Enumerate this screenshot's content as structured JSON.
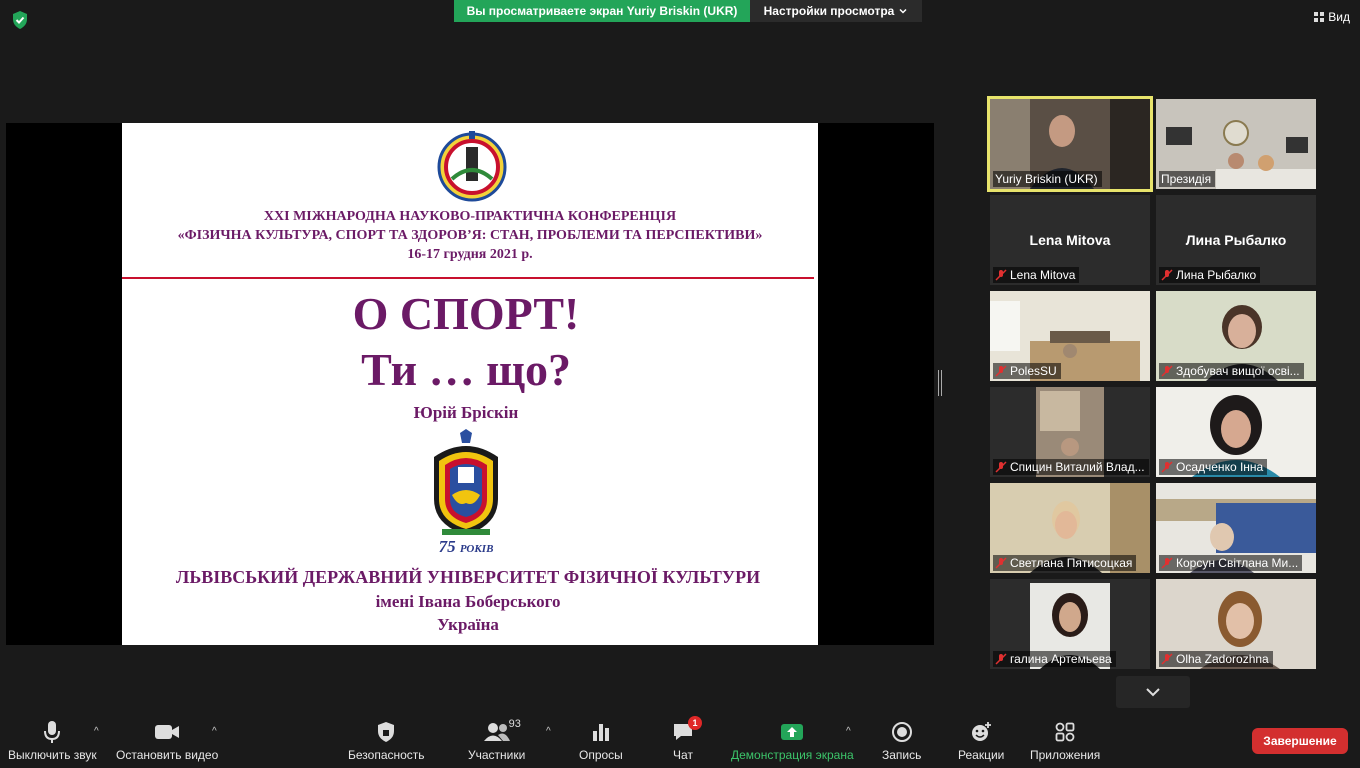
{
  "top": {
    "banner": "Вы просматриваете экран Yuriy Briskin (UKR)",
    "view_options": "Настройки просмотра",
    "view_button": "Вид"
  },
  "slide": {
    "conf_line1": "XXI МІЖНАРОДНА НАУКОВО-ПРАКТИЧНА КОНФЕРЕНЦІЯ",
    "conf_line2": "«ФІЗИЧНА КУЛЬТУРА, СПОРТ ТА ЗДОРОВ’Я: СТАН, ПРОБЛЕМИ ТА ПЕРСПЕКТИВИ»",
    "conf_dates": "16-17 грудня 2021 р.",
    "headline1": "О СПОРТ!",
    "headline2": "Ти … що?",
    "author": "Юрій Бріскін",
    "years_num": "75",
    "years_word": "РОКІВ",
    "univ_line1": "ЛЬВІВСЬКИЙ ДЕРЖАВНИЙ УНІВЕРСИТЕТ ФІЗИЧНОЇ КУЛЬТУРИ",
    "univ_line2": "імені Івана Боберського",
    "univ_line3": "Україна"
  },
  "participants": [
    {
      "label": "Yuriy Briskin (UKR)",
      "muted": false,
      "active": true
    },
    {
      "label": "Президія",
      "muted": false
    },
    {
      "label": "Lena Mitova",
      "name_card": "Lena Mitova",
      "muted": true
    },
    {
      "label": "Лина Рыбалко",
      "name_card": "Лина Рыбалко",
      "muted": true
    },
    {
      "label": "PolesSU",
      "muted": true
    },
    {
      "label": "Здобувач вищої осві...",
      "muted": true
    },
    {
      "label": "Спицин Виталий Влад...",
      "muted": true
    },
    {
      "label": "Осадченко Інна",
      "muted": true
    },
    {
      "label": "Светлана Пятисоцкая",
      "muted": true
    },
    {
      "label": "Корсун Світлана Ми...",
      "muted": true
    },
    {
      "label": "галина Артемьева",
      "muted": true
    },
    {
      "label": "Olha Zadorozhna",
      "muted": true
    }
  ],
  "toolbar": {
    "mute": "Выключить звук",
    "video": "Остановить видео",
    "security": "Безопасность",
    "participants": "Участники",
    "participants_count": "93",
    "polls": "Опросы",
    "chat": "Чат",
    "chat_badge": "1",
    "share": "Демонстрация экрана",
    "record": "Запись",
    "reactions": "Реакции",
    "apps": "Приложения",
    "end": "Завершение"
  },
  "colors": {
    "share_green": "#23a559",
    "slide_purple": "#6b1a66",
    "end_red": "#d32f2f",
    "active_speaker": "#e8e46c"
  }
}
